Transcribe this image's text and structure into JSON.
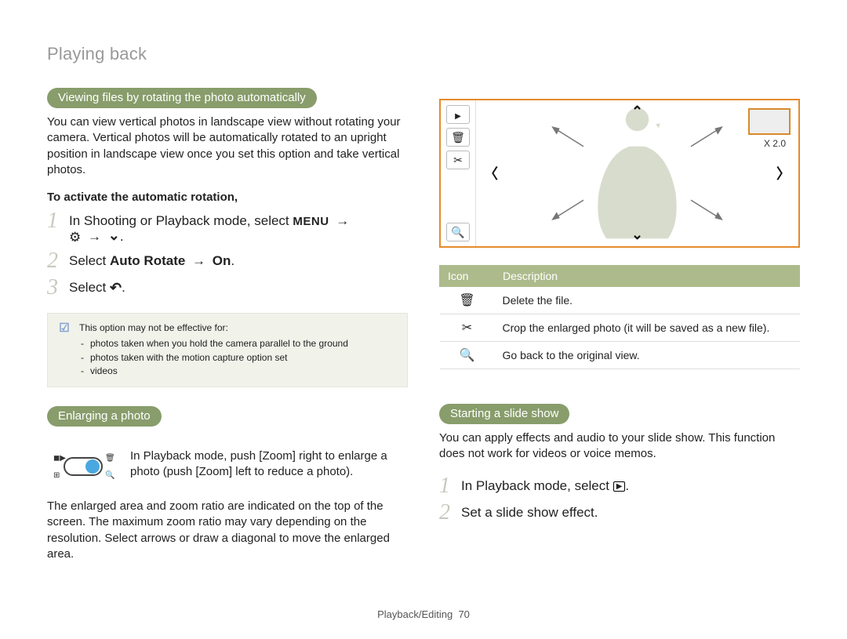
{
  "header": {
    "title": "Playing back"
  },
  "viewing": {
    "pill": "Viewing files by rotating the photo automatically",
    "para": "You can view vertical photos in landscape view without rotating your camera. Vertical photos will be automatically rotated to an upright position in landscape view once you set this option and take vertical photos.",
    "subhead": "To activate the automatic rotation,",
    "step1_a": "In Shooting or Playback mode, select ",
    "menu": "MENU",
    "arrow": "→",
    "step1_b": ".",
    "step2_a": "Select ",
    "step2_b": "Auto Rotate",
    "step2_c": "On",
    "step2_d": ".",
    "step3_a": "Select ",
    "step3_b": "."
  },
  "note": {
    "lead": "This option may not be effective for:",
    "items": [
      "photos taken when you hold the camera parallel to the ground",
      "photos taken with the motion capture option set",
      "videos"
    ]
  },
  "enlarging": {
    "pill": "Enlarging a photo",
    "zoom_a": "In Playback mode, push [",
    "zoom_b": "Zoom",
    "zoom_c": "] right to enlarge a photo (push [",
    "zoom_d": "Zoom",
    "zoom_e": "] left to reduce a photo).",
    "para2": "The enlarged area and zoom ratio are indicated on the top of the screen. The maximum zoom ratio may vary depending on the resolution. Select arrows or draw a diagonal to move the enlarged area."
  },
  "preview": {
    "zoom_label": "X 2.0"
  },
  "icon_table": {
    "h_icon": "Icon",
    "h_desc": "Description",
    "rows": [
      {
        "icon": "🗑",
        "desc": "Delete the file."
      },
      {
        "icon": "✂",
        "desc": "Crop the enlarged photo (it will be saved as a new file)."
      },
      {
        "icon": "🔍",
        "desc": "Go back to the original view."
      }
    ]
  },
  "slideshow": {
    "pill": "Starting a slide show",
    "para": "You can apply effects and audio to your slide show. This function does not work for videos or voice memos.",
    "step1_a": "In Playback mode, select ",
    "step1_b": ".",
    "step2": "Set a slide show effect."
  },
  "footer": {
    "section": "Playback/Editing",
    "page": "70"
  }
}
